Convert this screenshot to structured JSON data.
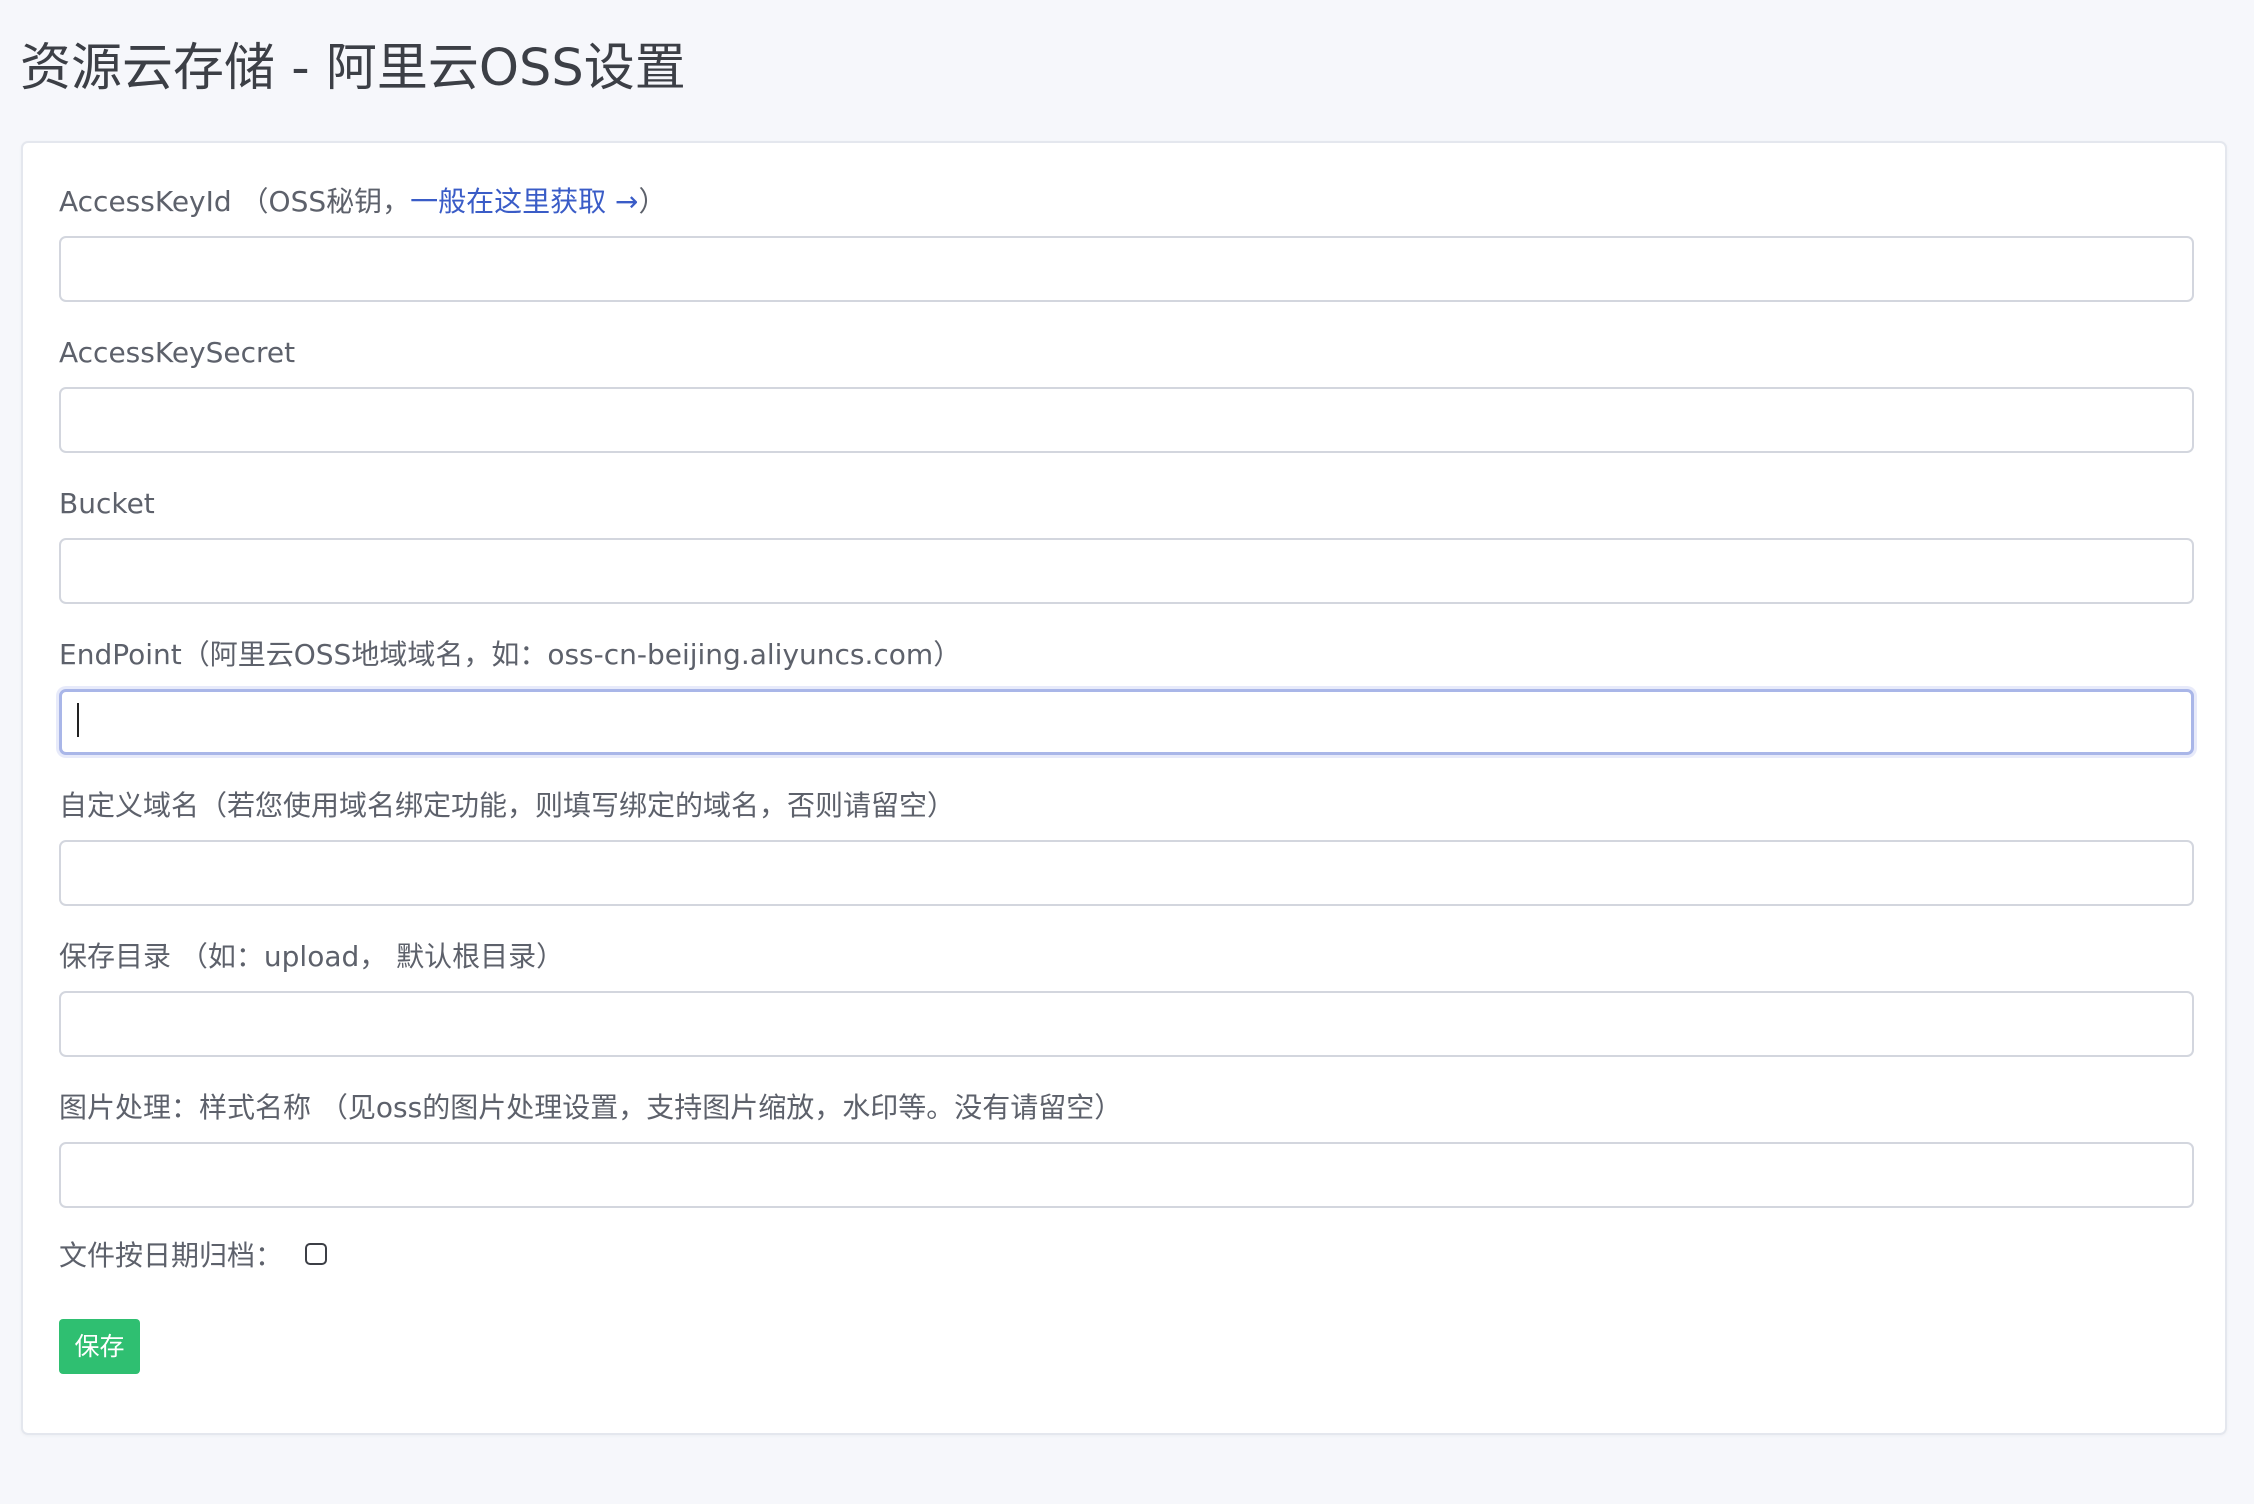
{
  "page": {
    "title": "资源云存储 - 阿里云OSS设置"
  },
  "form": {
    "access_key_id": {
      "label": "AccessKeyId （OSS秘钥，",
      "link_text": "一般在这里获取 →",
      "label_suffix": "）",
      "value": ""
    },
    "access_key_secret": {
      "label": "AccessKeySecret",
      "value": ""
    },
    "bucket": {
      "label": "Bucket",
      "value": ""
    },
    "endpoint": {
      "label": "EndPoint（阿里云OSS地域域名，如：oss-cn-beijing.aliyuncs.com）",
      "value": ""
    },
    "custom_domain": {
      "label": "自定义域名（若您使用域名绑定功能，则填写绑定的域名，否则请留空）",
      "value": ""
    },
    "save_dir": {
      "label": "保存目录 （如：upload， 默认根目录）",
      "value": ""
    },
    "image_style": {
      "label": "图片处理：样式名称 （见oss的图片处理设置，支持图片缩放，水印等。没有请留空）",
      "value": ""
    },
    "archive_by_date": {
      "label": "文件按日期归档：",
      "checked": false
    },
    "save_label": "保存"
  },
  "colors": {
    "accent_link": "#3a5cc7",
    "save_button": "#2fbf71",
    "focus_border": "#a9b6e8"
  }
}
